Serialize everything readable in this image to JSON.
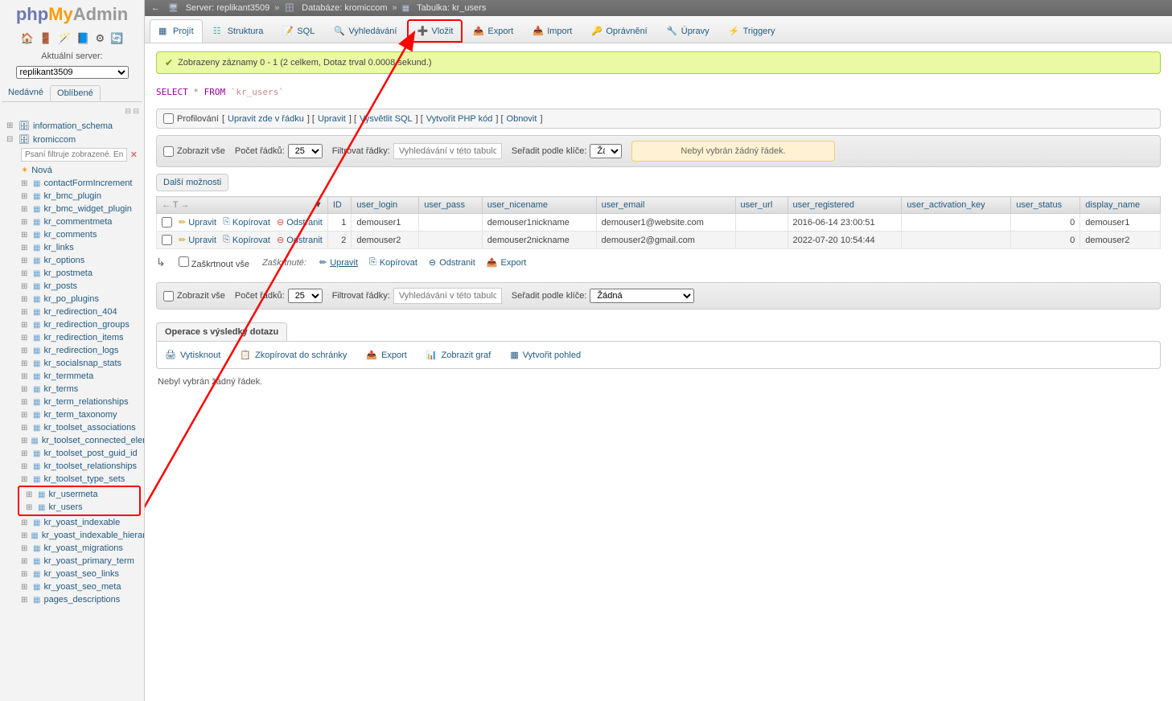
{
  "logo": {
    "php": "php",
    "my": "My",
    "admin": "Admin"
  },
  "sidebar": {
    "current_server_label": "Aktuální server:",
    "current_server": "replikant3509",
    "recent": "Nedávné",
    "favorites": "Oblíbené",
    "filter_placeholder": "Psaní filtruje zobrazené. Ente",
    "db1": "information_schema",
    "db2": "kromiccom",
    "new_label": "Nová",
    "tables": [
      "contactFormIncrement",
      "kr_bmc_plugin",
      "kr_bmc_widget_plugin",
      "kr_commentmeta",
      "kr_comments",
      "kr_links",
      "kr_options",
      "kr_postmeta",
      "kr_posts",
      "kr_po_plugins",
      "kr_redirection_404",
      "kr_redirection_groups",
      "kr_redirection_items",
      "kr_redirection_logs",
      "kr_socialsnap_stats",
      "kr_termmeta",
      "kr_terms",
      "kr_term_relationships",
      "kr_term_taxonomy",
      "kr_toolset_associations",
      "kr_toolset_connected_elemen",
      "kr_toolset_post_guid_id",
      "kr_toolset_relationships",
      "kr_toolset_type_sets",
      "kr_usermeta",
      "kr_users",
      "kr_yoast_indexable",
      "kr_yoast_indexable_hierarchy",
      "kr_yoast_migrations",
      "kr_yoast_primary_term",
      "kr_yoast_seo_links",
      "kr_yoast_seo_meta",
      "pages_descriptions"
    ]
  },
  "breadcrumb": {
    "server_label": "Server:",
    "server": "replikant3509",
    "db_label": "Databáze:",
    "db": "kromiccom",
    "table_label": "Tabulka:",
    "table": "kr_users"
  },
  "tabs": {
    "browse": "Projít",
    "structure": "Struktura",
    "sql": "SQL",
    "search": "Vyhledávání",
    "insert": "Vložit",
    "export": "Export",
    "import": "Import",
    "privileges": "Oprávnění",
    "operations": "Úpravy",
    "triggers": "Triggery"
  },
  "success_msg": "Zobrazeny záznamy 0 - 1 (2 celkem, Dotaz trval 0.0008 sekund.)",
  "sql": {
    "select": "SELECT",
    "star": "*",
    "from": "FROM",
    "table": "`kr_users`"
  },
  "profiling": {
    "checkbox": "Profilování",
    "edit_inline": "Upravit zde v řádku",
    "edit": "Upravit",
    "explain": "Vysvětlit SQL",
    "php": "Vytvořit PHP kód",
    "refresh": "Obnovit"
  },
  "controls": {
    "show_all": "Zobrazit vše",
    "row_count": "Počet řádků:",
    "row_value": "25",
    "filter_rows": "Filtrovat řádky:",
    "search_placeholder": "Vyhledávání v této tabulce",
    "sort_by": "Seřadit podle klíče:",
    "sort_none": "Žádná",
    "warning": "Nebyl vybrán žádný řádek."
  },
  "more_options": "Další možnosti",
  "columns": [
    "ID",
    "user_login",
    "user_pass",
    "user_nicename",
    "user_email",
    "user_url",
    "user_registered",
    "user_activation_key",
    "user_status",
    "display_name"
  ],
  "row_action": {
    "edit": "Upravit",
    "copy": "Kopírovat",
    "delete": "Odstranit"
  },
  "rows": [
    {
      "id": "1",
      "login": "demouser1",
      "pass": "",
      "nice": "demouser1nickname",
      "email": "demouser1@website.com",
      "url": "",
      "reg": "2016-06-14 23:00:51",
      "key": "",
      "status": "0",
      "display": "demouser1"
    },
    {
      "id": "2",
      "login": "demouser2",
      "pass": "",
      "nice": "demouser2nickname",
      "email": "demouser2@gmail.com",
      "url": "",
      "reg": "2022-07-20 10:54:44",
      "key": "",
      "status": "0",
      "display": "demouser2"
    }
  ],
  "bulk": {
    "check_all": "Zaškrtnout vše",
    "with_selected": "Zaškrtnuté:",
    "edit": "Upravit",
    "copy": "Kopírovat",
    "delete": "Odstranit",
    "export": "Export"
  },
  "ops": {
    "title": "Operace s výsledky dotazu",
    "print": "Vytisknout",
    "clipboard": "Zkopírovat do schránky",
    "export": "Export",
    "chart": "Zobrazit graf",
    "view": "Vytvořit pohled"
  },
  "status": "Nebyl vybrán žádný řádek."
}
